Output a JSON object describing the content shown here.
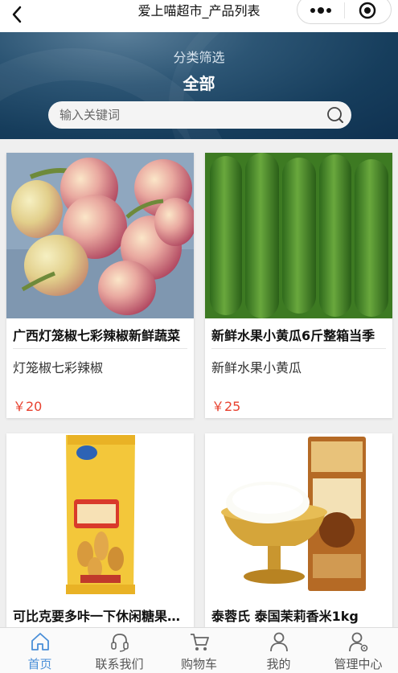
{
  "navbar": {
    "title": "爱上喵超市_产品列表",
    "back_icon": "chevron-left-icon",
    "more_icon": "more-dots-icon",
    "close_icon": "target-close-icon"
  },
  "banner": {
    "filter_label": "分类筛选",
    "filter_value": "全部",
    "search": {
      "placeholder": "输入关键词",
      "value": "",
      "icon": "search-icon"
    }
  },
  "products": [
    {
      "name": "广西灯笼椒七彩辣椒新鲜蔬菜",
      "desc": "灯笼椒七彩辣椒",
      "price": "￥20",
      "image": "pepper-photo"
    },
    {
      "name": "新鲜水果小黄瓜6斤整箱当季",
      "desc": "新鲜水果小黄瓜",
      "price": "￥25",
      "image": "cucumber-photo"
    },
    {
      "name": "可比克要多咔一下休闲糖果零食",
      "desc": "",
      "price": "",
      "image": "snack-bag-photo"
    },
    {
      "name": "泰蓉氏 泰国茉莉香米1kg",
      "desc": "",
      "price": "",
      "image": "rice-bag-photo"
    }
  ],
  "tabbar": {
    "tabs": [
      {
        "label": "首页",
        "icon": "home-icon",
        "active": true
      },
      {
        "label": "联系我们",
        "icon": "headset-icon",
        "active": false
      },
      {
        "label": "购物车",
        "icon": "cart-icon",
        "active": false
      },
      {
        "label": "我的",
        "icon": "user-icon",
        "active": false
      },
      {
        "label": "管理中心",
        "icon": "user-settings-icon",
        "active": false
      }
    ]
  },
  "colors": {
    "accent": "#4a8fd8",
    "price": "#e8412f",
    "banner": "#1f4a6b"
  }
}
